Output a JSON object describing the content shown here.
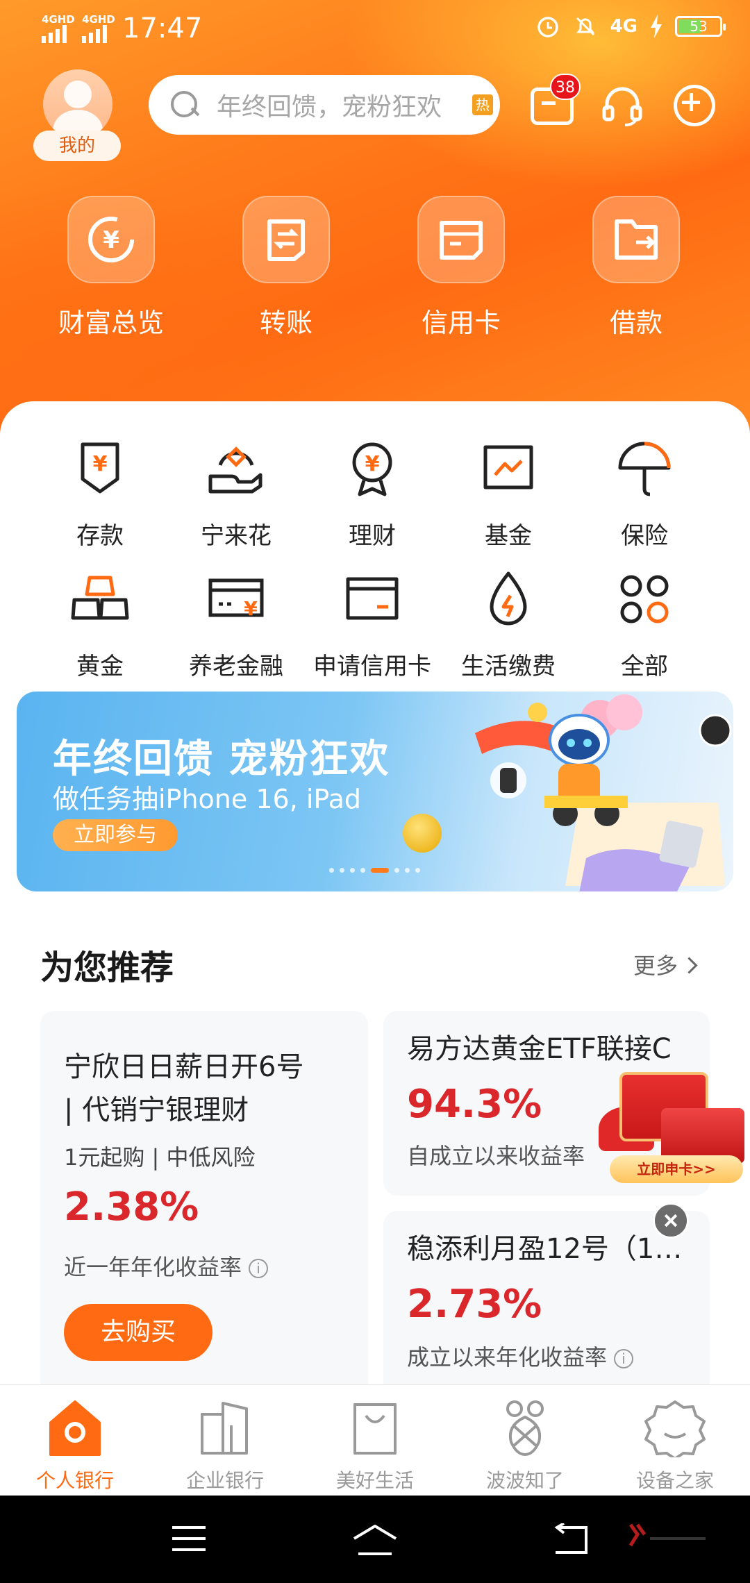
{
  "status_bar": {
    "sim1_label": "4GHD",
    "sim2_label": "4GHD",
    "time": "17:47",
    "network": "4G",
    "battery": "53"
  },
  "header": {
    "avatar_label": "我的",
    "search_placeholder": "年终回馈，宠粉狂欢",
    "hot_tag": "热",
    "message_count": "38"
  },
  "quick_actions": [
    {
      "label": "财富总览",
      "icon": "wealth-overview-icon"
    },
    {
      "label": "转账",
      "icon": "transfer-icon"
    },
    {
      "label": "信用卡",
      "icon": "credit-card-icon"
    },
    {
      "label": "借款",
      "icon": "loan-icon"
    }
  ],
  "services": [
    {
      "label": "存款",
      "icon": "deposit-icon"
    },
    {
      "label": "宁来花",
      "icon": "ninglaihua-icon"
    },
    {
      "label": "理财",
      "icon": "wealth-management-icon"
    },
    {
      "label": "基金",
      "icon": "fund-icon"
    },
    {
      "label": "保险",
      "icon": "insurance-icon"
    },
    {
      "label": "黄金",
      "icon": "gold-icon"
    },
    {
      "label": "养老金融",
      "icon": "pension-icon"
    },
    {
      "label": "申请信用卡",
      "icon": "apply-card-icon"
    },
    {
      "label": "生活缴费",
      "icon": "utility-payment-icon"
    },
    {
      "label": "全部",
      "icon": "all-services-icon"
    }
  ],
  "banner": {
    "title": "年终回馈 宠粉狂欢",
    "subtitle": "做任务抽iPhone 16, iPad",
    "cta": "立即参与",
    "active_dot": 5,
    "dot_count": 8
  },
  "recommend": {
    "title": "为您推荐",
    "more": "更多",
    "products": [
      {
        "name_line1": "宁欣日日薪日开6号",
        "name_line2": "| 代销宁银理财",
        "tags": "1元起购 | 中低风险",
        "rate": "2.38%",
        "rate_desc": "近一年年化收益率",
        "button": "去购买"
      },
      {
        "name": "易方达黄金ETF联接C",
        "rate": "94.3%",
        "rate_desc": "自成立以来收益率"
      },
      {
        "name": "稳添利月盈12号（1…",
        "rate": "2.73%",
        "rate_desc": "成立以来年化收益率"
      }
    ]
  },
  "floating_ad": {
    "cta": "立即申卡>>"
  },
  "tab_bar": [
    {
      "label": "个人银行",
      "active": true
    },
    {
      "label": "企业银行",
      "active": false
    },
    {
      "label": "美好生活",
      "active": false
    },
    {
      "label": "波波知了",
      "active": false
    },
    {
      "label": "设备之家",
      "active": false
    }
  ],
  "colors": {
    "brand_orange": "#ff6a12",
    "rate_red": "#d9272b"
  }
}
